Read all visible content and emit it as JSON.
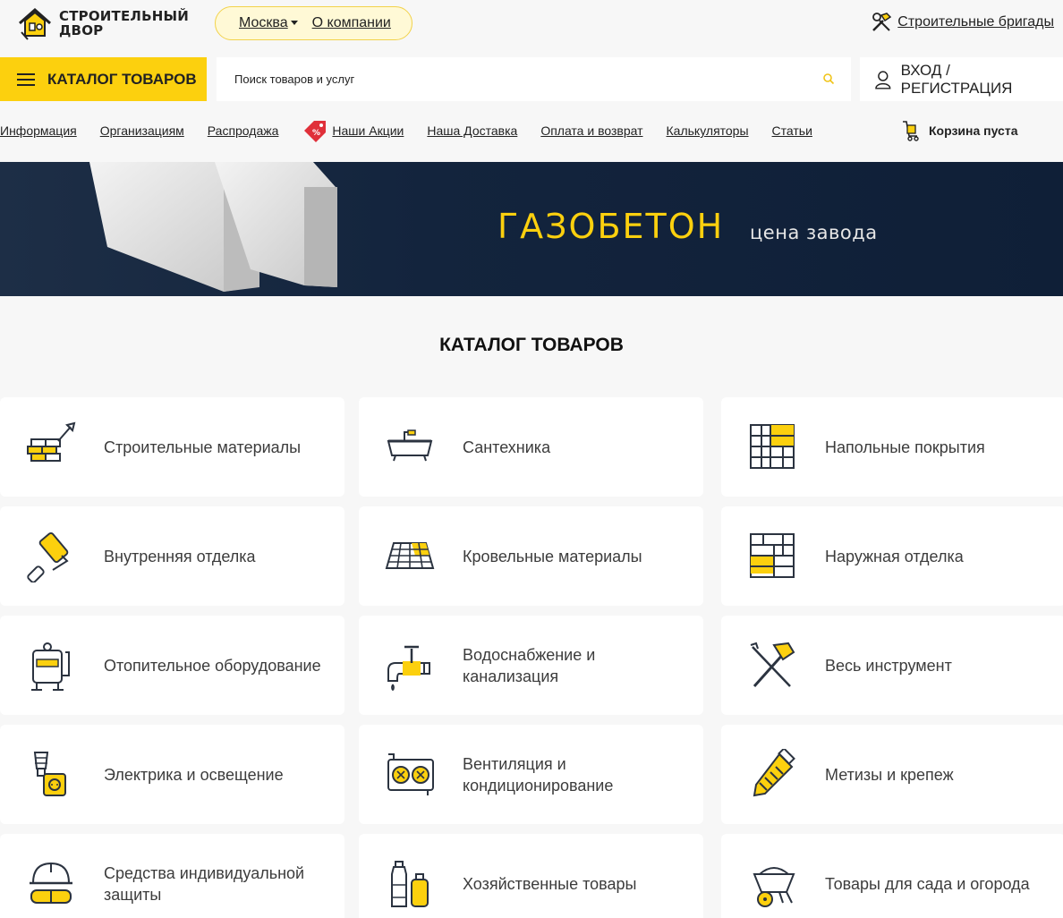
{
  "header": {
    "logo_line1": "СТРОИТЕЛЬНЫЙ",
    "logo_line2": "ДВОР",
    "city": "Москва",
    "about": "О компании",
    "brigades": "Строительные бригады"
  },
  "search": {
    "catalog_label": "КАТАЛОГ ТОВАРОВ",
    "placeholder": "Поиск товаров и услуг",
    "login_label": "ВХОД / РЕГИСТРАЦИЯ"
  },
  "nav": {
    "items": [
      "Информация",
      "Организациям",
      "Распродажа",
      "Наши Акции",
      "Наша Доставка",
      "Оплата и возврат",
      "Калькуляторы",
      "Статьи"
    ],
    "cart_label": "Корзина пуста"
  },
  "banner": {
    "title": "ГАЗОБЕТОН",
    "subtitle": "цена завода"
  },
  "catalog": {
    "title": "КАТАЛОГ ТОВАРОВ",
    "categories": [
      {
        "label": "Строительные материалы",
        "icon": "bricks-trowel-icon"
      },
      {
        "label": "Сантехника",
        "icon": "bathtub-icon"
      },
      {
        "label": "Напольные покрытия",
        "icon": "floor-tiles-icon"
      },
      {
        "label": "Внутренняя отделка",
        "icon": "paint-roller-icon"
      },
      {
        "label": "Кровельные материалы",
        "icon": "roof-tiles-icon"
      },
      {
        "label": "Наружная отделка",
        "icon": "facade-panels-icon"
      },
      {
        "label": "Отопительное оборудование",
        "icon": "boiler-icon"
      },
      {
        "label": "Водоснабжение и канализация",
        "icon": "water-tap-icon"
      },
      {
        "label": "Весь инструмент",
        "icon": "hammer-screwdriver-icon"
      },
      {
        "label": "Электрика и освещение",
        "icon": "bulb-socket-icon"
      },
      {
        "label": "Вентиляция и кондиционирование",
        "icon": "ventilation-unit-icon"
      },
      {
        "label": "Метизы и крепеж",
        "icon": "screw-icon"
      },
      {
        "label": "Средства индивидуальной защиты",
        "icon": "helmet-goggles-icon"
      },
      {
        "label": "Хозяйственные товары",
        "icon": "cleaning-bottles-icon"
      },
      {
        "label": "Товары для сада и огорода",
        "icon": "wheelbarrow-icon"
      }
    ]
  },
  "colors": {
    "accent": "#fcd00e",
    "banner_bg": "#13243d",
    "icon_stroke": "#2b3340"
  }
}
